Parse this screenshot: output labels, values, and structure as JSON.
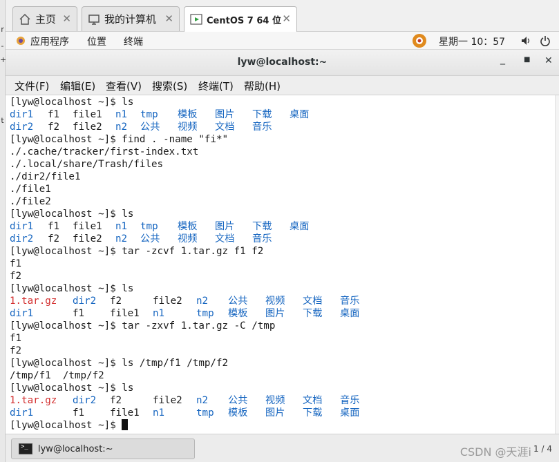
{
  "vm_tabs": [
    {
      "label": "主页",
      "icon": "home-icon"
    },
    {
      "label": "我的计算机",
      "icon": "computer-icon"
    },
    {
      "label": "CentOS 7 64 位",
      "icon": "vm-icon"
    }
  ],
  "side_marks": [
    "r",
    "-",
    "+",
    "t"
  ],
  "topbar": {
    "applications": "应用程序",
    "places": "位置",
    "terminal": "终端",
    "datetime": "星期一 10：57"
  },
  "window": {
    "title": "lyw@localhost:~"
  },
  "menu": [
    "文件(F)",
    "编辑(E)",
    "查看(V)",
    "搜索(S)",
    "终端(T)",
    "帮助(H)"
  ],
  "terminal_lines": [
    "[lyw@localhost ~]$ ls",
    "dir1  f1  file1  n1  tmp  模板  图片  下载  桌面",
    "dir2  f2  file2  n2  公共  视频  文档  音乐",
    "[lyw@localhost ~]$ find . -name \"fi*\"",
    "./.cache/tracker/first-index.txt",
    "./.local/share/Trash/files",
    "./dir2/file1",
    "./file1",
    "./file2",
    "[lyw@localhost ~]$ ls",
    "dir1  f1  file1  n1  tmp  模板  图片  下载  桌面",
    "dir2  f2  file2  n2  公共  视频  文档  音乐",
    "[lyw@localhost ~]$ tar -zcvf 1.tar.gz f1 f2",
    "f1",
    "f2",
    "[lyw@localhost ~]$ ls",
    "1.tar.gz  dir2  f2  file2  n2  公共  视频  文档  音乐",
    "dir1  f1  file1  n1  tmp  模板  图片  下载  桌面",
    "[lyw@localhost ~]$ tar -zxvf 1.tar.gz -C /tmp",
    "f1",
    "f2",
    "[lyw@localhost ~]$ ls /tmp/f1 /tmp/f2",
    "/tmp/f1  /tmp/f2",
    "[lyw@localhost ~]$ ls",
    "1.tar.gz  dir2  f2  file2  n2  公共  视频  文档  音乐",
    "dir1  f1  file1  n1  tmp  模板  图片  下载  桌面",
    "[lyw@localhost ~]$ "
  ],
  "taskbar": {
    "window_label": "lyw@localhost:~",
    "pager": "1 / 4"
  },
  "watermark": "CSDN @天涯i",
  "colors": {
    "directory": "#1565c0",
    "archive": "#d32f2f",
    "text": "#1a1a1a"
  }
}
